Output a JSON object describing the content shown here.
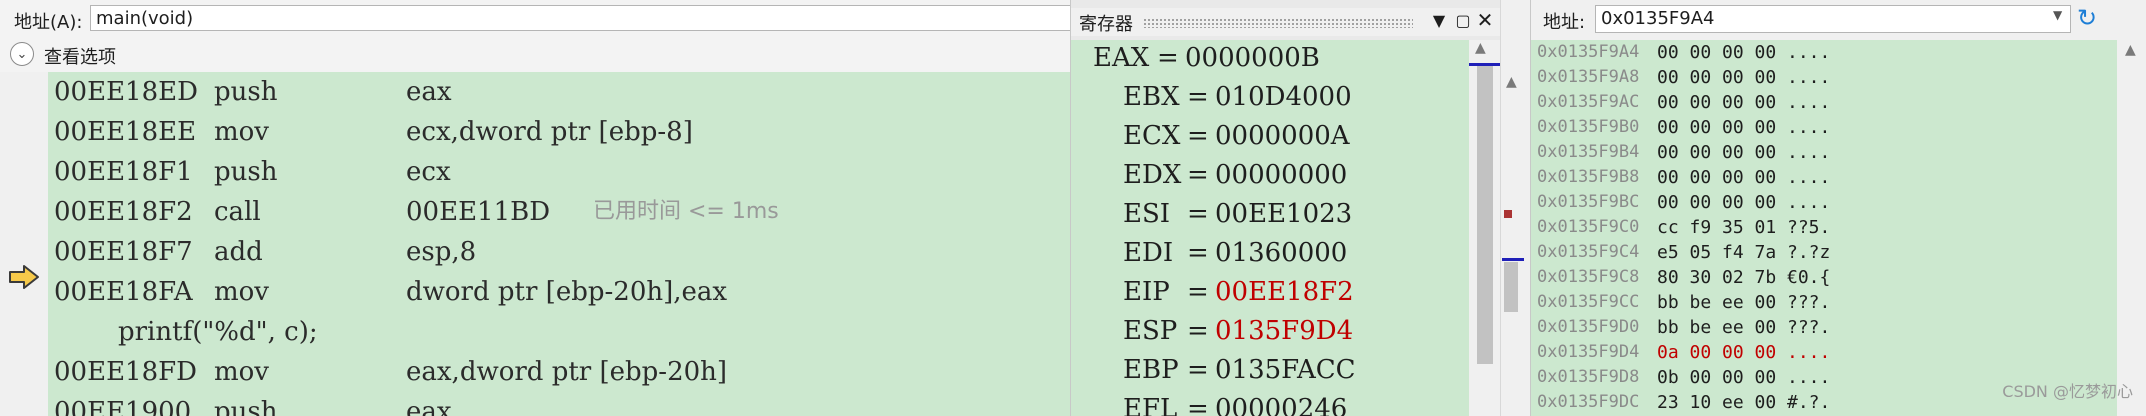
{
  "disassembly": {
    "address_label": "地址(A):",
    "address_value": "main(void)",
    "view_options_label": "查看选项",
    "rows": [
      {
        "type": "asm",
        "address": "00EE18ED",
        "mnemonic": "push",
        "operands": "eax"
      },
      {
        "type": "asm",
        "address": "00EE18EE",
        "mnemonic": "mov",
        "operands": "ecx,dword ptr [ebp-8]"
      },
      {
        "type": "asm",
        "address": "00EE18F1",
        "mnemonic": "push",
        "operands": "ecx"
      },
      {
        "type": "asm",
        "address": "00EE18F2",
        "mnemonic": "call",
        "operands": "00EE11BD",
        "timing": "已用时间 <= 1ms",
        "current": true
      },
      {
        "type": "asm",
        "address": "00EE18F7",
        "mnemonic": "add",
        "operands": "esp,8"
      },
      {
        "type": "asm",
        "address": "00EE18FA",
        "mnemonic": "mov",
        "operands": "dword ptr [ebp-20h],eax"
      },
      {
        "type": "source",
        "text": "printf(\"%d\", c);"
      },
      {
        "type": "asm",
        "address": "00EE18FD",
        "mnemonic": "mov",
        "operands": "eax,dword ptr [ebp-20h]"
      },
      {
        "type": "asm",
        "address": "00EE1900",
        "mnemonic": "push",
        "operands": "eax"
      }
    ]
  },
  "registers": {
    "title": "寄存器",
    "menu_icon": "dropdown-triangle-icon",
    "maximize_icon": "maximize-icon",
    "close_icon": "close-icon",
    "items": [
      {
        "name": "EAX",
        "value": "0000000B",
        "changed": false
      },
      {
        "name": "EBX",
        "value": "010D4000",
        "changed": false
      },
      {
        "name": "ECX",
        "value": "0000000A",
        "changed": false
      },
      {
        "name": "EDX",
        "value": "00000000",
        "changed": false
      },
      {
        "name": "ESI",
        "value": "00EE1023",
        "changed": false
      },
      {
        "name": "EDI",
        "value": "01360000",
        "changed": false
      },
      {
        "name": "EIP",
        "value": "00EE18F2",
        "changed": true
      },
      {
        "name": "ESP",
        "value": "0135F9D4",
        "changed": true
      },
      {
        "name": "EBP",
        "value": "0135FACC",
        "changed": false
      },
      {
        "name": "EFL",
        "value": "00000246",
        "changed": false
      }
    ]
  },
  "memory": {
    "address_label": "地址:",
    "address_value": "0x0135F9A4",
    "rows": [
      {
        "address": "0x0135F9A4",
        "bytes": "00 00 00 00",
        "ascii": "....",
        "changed": false
      },
      {
        "address": "0x0135F9A8",
        "bytes": "00 00 00 00",
        "ascii": "....",
        "changed": false
      },
      {
        "address": "0x0135F9AC",
        "bytes": "00 00 00 00",
        "ascii": "....",
        "changed": false
      },
      {
        "address": "0x0135F9B0",
        "bytes": "00 00 00 00",
        "ascii": "....",
        "changed": false
      },
      {
        "address": "0x0135F9B4",
        "bytes": "00 00 00 00",
        "ascii": "....",
        "changed": false
      },
      {
        "address": "0x0135F9B8",
        "bytes": "00 00 00 00",
        "ascii": "....",
        "changed": false
      },
      {
        "address": "0x0135F9BC",
        "bytes": "00 00 00 00",
        "ascii": "....",
        "changed": false
      },
      {
        "address": "0x0135F9C0",
        "bytes": "cc f9 35 01",
        "ascii": "??5.",
        "changed": false
      },
      {
        "address": "0x0135F9C4",
        "bytes": "e5 05 f4 7a",
        "ascii": "?.?z",
        "changed": false
      },
      {
        "address": "0x0135F9C8",
        "bytes": "80 30 02 7b",
        "ascii": "€0.{",
        "changed": false
      },
      {
        "address": "0x0135F9CC",
        "bytes": "bb be ee 00",
        "ascii": "???.",
        "changed": false
      },
      {
        "address": "0x0135F9D0",
        "bytes": "bb be ee 00",
        "ascii": "???.",
        "changed": false
      },
      {
        "address": "0x0135F9D4",
        "bytes": "0a 00 00 00",
        "ascii": "....",
        "changed": true
      },
      {
        "address": "0x0135F9D8",
        "bytes": "0b 00 00 00",
        "ascii": "....",
        "changed": false
      },
      {
        "address": "0x0135F9DC",
        "bytes": "23 10 ee 00",
        "ascii": "#.?.",
        "changed": false
      }
    ]
  },
  "watermark": "CSDN @忆梦初心"
}
